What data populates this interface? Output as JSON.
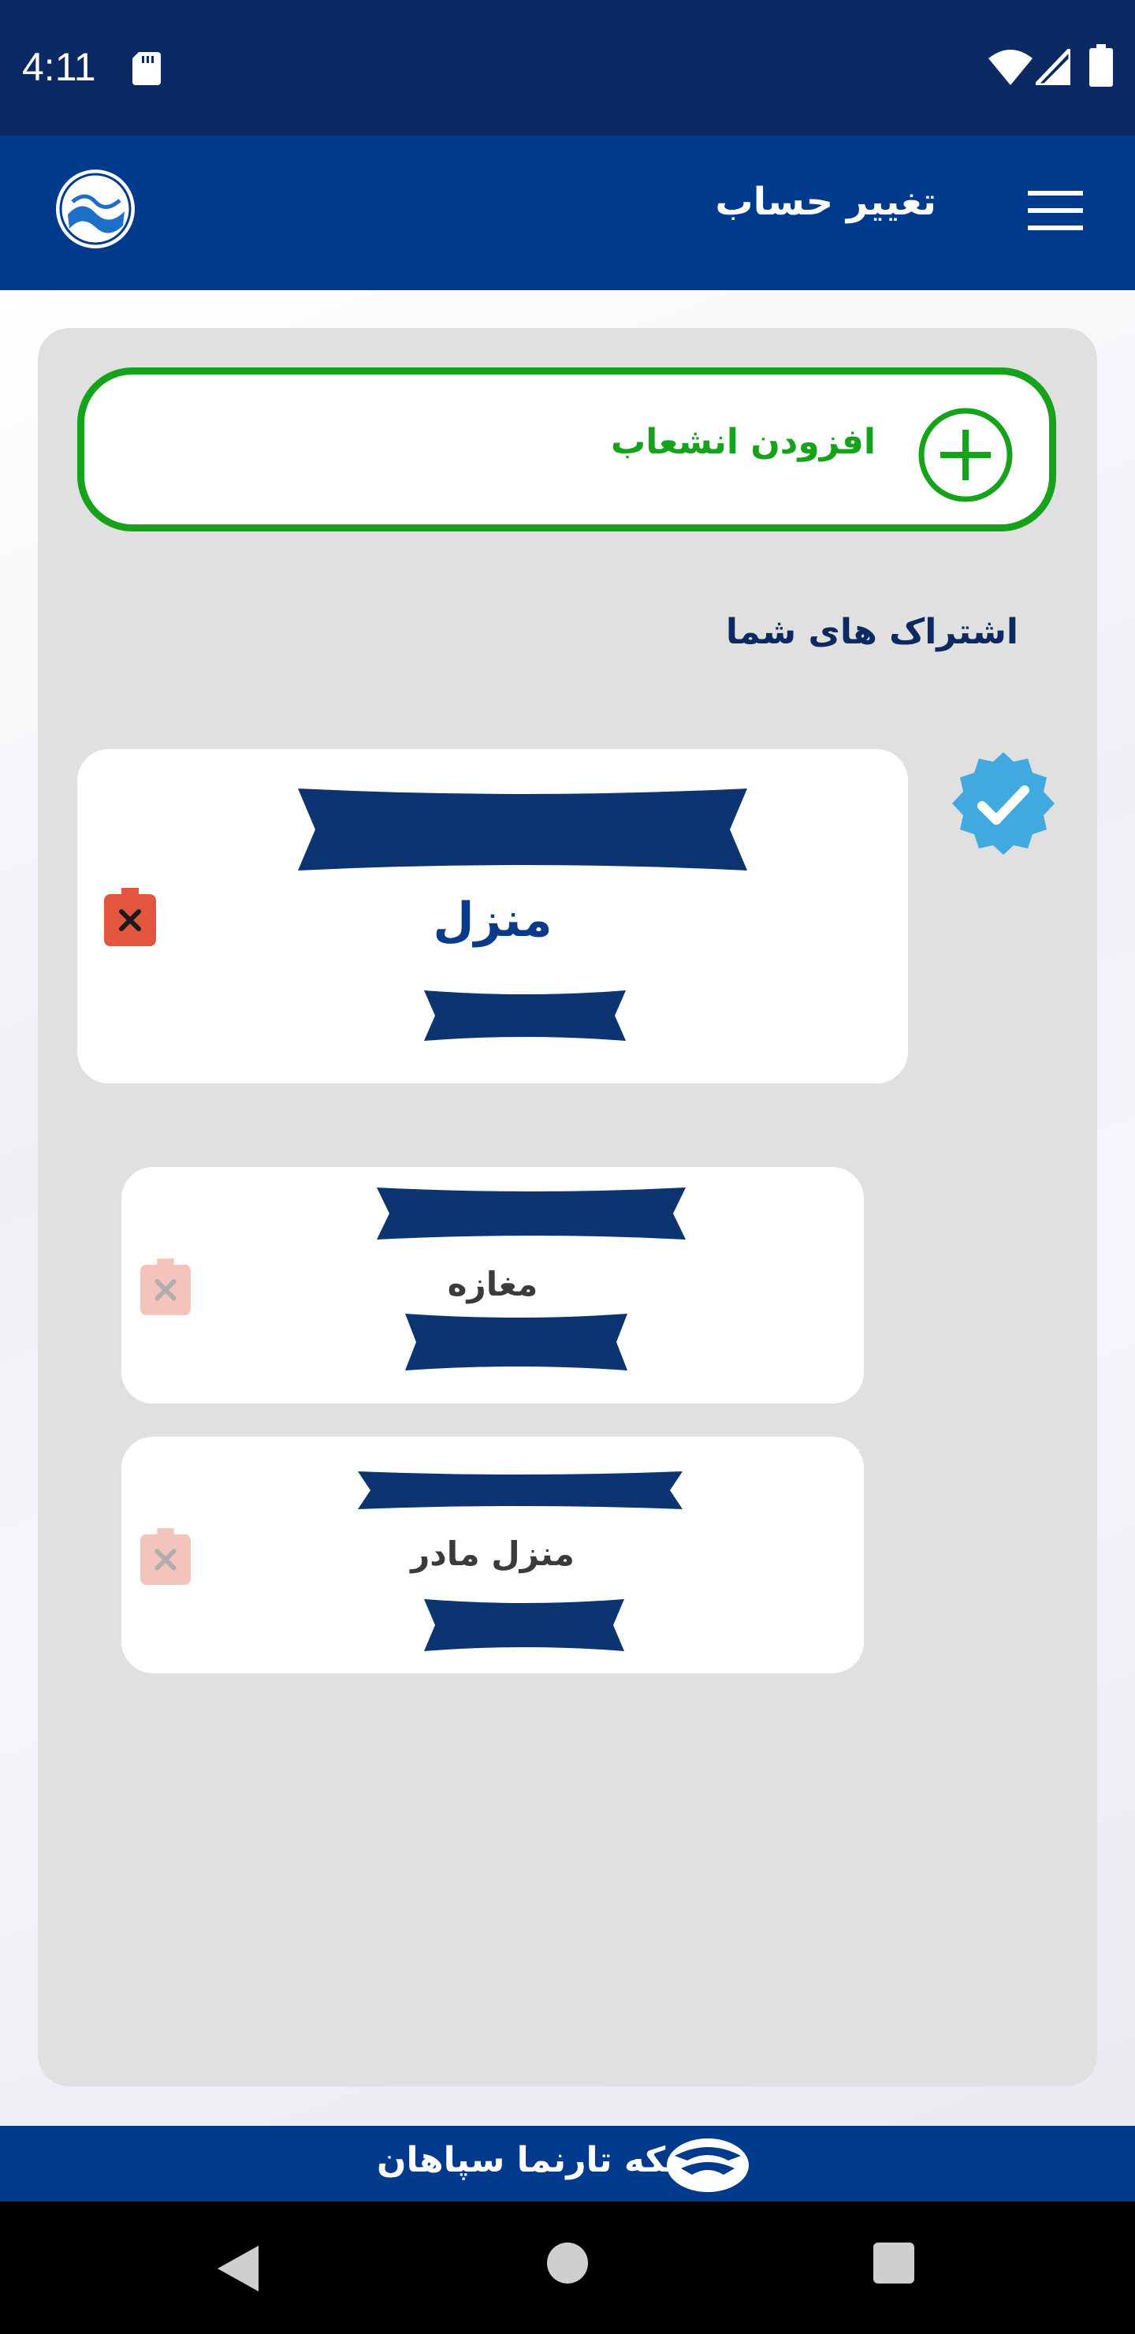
{
  "status_bar": {
    "time": "4:11"
  },
  "app_bar": {
    "title": "تغییر حساب"
  },
  "add_branch": {
    "label": "افزودن انشعاب"
  },
  "section": {
    "title": "اشتراک های شما"
  },
  "subscriptions": [
    {
      "name": "منزل",
      "active": true
    },
    {
      "name": "مغازه",
      "active": false
    },
    {
      "name": "منزل مادر",
      "active": false
    }
  ],
  "footer": {
    "text": "شبکه تارنما سپاهان"
  },
  "colors": {
    "primary": "#003a8c",
    "dark": "#0b2a63",
    "green": "#17a21c",
    "danger": "#e2553f",
    "badge": "#3fa9e0"
  }
}
